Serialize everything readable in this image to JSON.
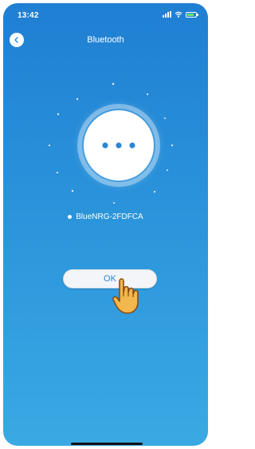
{
  "status_bar": {
    "time": "13:42"
  },
  "header": {
    "title": "Bluetooth",
    "back_icon": "chevron-left-icon"
  },
  "scan": {
    "state_icon": "loading-dots-icon"
  },
  "device": {
    "name": "BlueNRG-2FDFCA"
  },
  "actions": {
    "ok_label": "OK"
  },
  "colors": {
    "background_top": "#1f7fd3",
    "background_bottom": "#3aa9e3",
    "button_text": "#2a86d8"
  }
}
